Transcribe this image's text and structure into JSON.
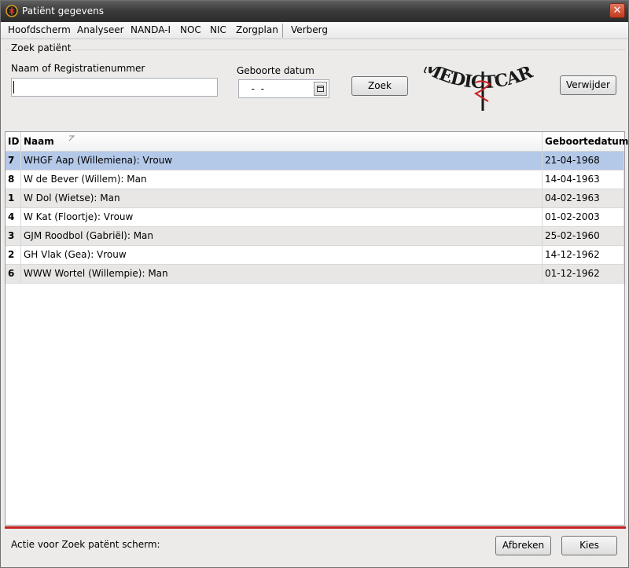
{
  "window": {
    "title": "Patiënt gegevens"
  },
  "menu": [
    "Hoofdscherm",
    "Analyseer",
    "NANDA-I",
    "NOC",
    "NIC",
    "Zorgplan",
    "Verberg"
  ],
  "search": {
    "group_title": "Zoek patiënt",
    "name_label": "Naam of Registratienummer",
    "name_value": "",
    "date_label": "Geboorte datum",
    "date_value": "  -  -",
    "search_button": "Zoek",
    "delete_button": "Verwijder"
  },
  "logo": {
    "text": "MEDICTCARE"
  },
  "table": {
    "columns": [
      "ID",
      "Naam",
      "Geboortedatum"
    ],
    "rows": [
      {
        "id": "7",
        "name": "WHGF Aap  (Willemiena): Vrouw",
        "dob": "21-04-1968"
      },
      {
        "id": "8",
        "name": "W de Bever  (Willem): Man",
        "dob": "14-04-1963"
      },
      {
        "id": "1",
        "name": "W Dol  (Wietse): Man",
        "dob": "04-02-1963"
      },
      {
        "id": "4",
        "name": "W Kat  (Floortje): Vrouw",
        "dob": "01-02-2003"
      },
      {
        "id": "3",
        "name": "GJM Roodbol  (Gabriël): Man",
        "dob": "25-02-1960"
      },
      {
        "id": "2",
        "name": "GH Vlak  (Gea): Vrouw",
        "dob": "14-12-1962"
      },
      {
        "id": "6",
        "name": "WWW Wortel  (Willempie): Man",
        "dob": "01-12-1962"
      }
    ],
    "selected_index": 0
  },
  "footer": {
    "status": "Actie voor Zoek patënt scherm:",
    "cancel_button": "Afbreken",
    "ok_button": "Kies"
  },
  "colors": {
    "selected_row": "#b4c8e8",
    "alt_row": "#e8e7e6",
    "accent_line": "#c8201f"
  }
}
